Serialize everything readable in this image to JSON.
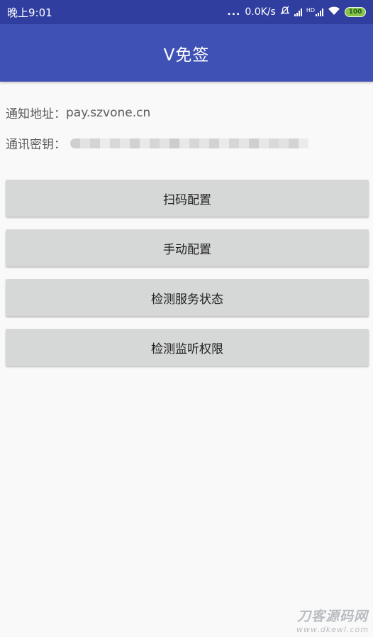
{
  "status_bar": {
    "time": "晚上9:01",
    "dots": "...",
    "speed": "0.0K/s",
    "network_label": "HD",
    "battery": "100",
    "bg_color": "#303f9f"
  },
  "app_bar": {
    "title": "V免签",
    "bg_color": "#3f51b5"
  },
  "info": {
    "address_label": "通知地址：",
    "address_value": "pay.szvone.cn",
    "key_label": "通讯密钥："
  },
  "buttons": {
    "scan_config": "扫码配置",
    "manual_config": "手动配置",
    "check_service": "检测服务状态",
    "check_permission": "检测监听权限"
  },
  "watermark": {
    "logo": "刀客源码网",
    "url": "www.dkewl.com"
  }
}
